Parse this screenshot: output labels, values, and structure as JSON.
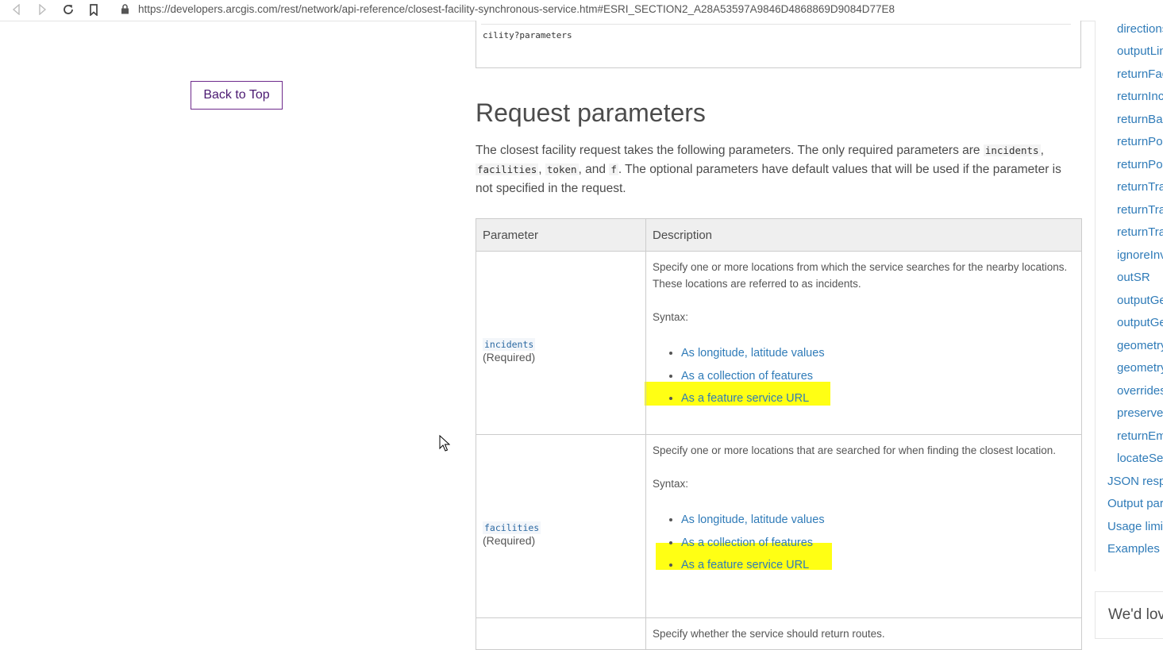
{
  "browser": {
    "url": "https://developers.arcgis.com/rest/network/api-reference/closest-facility-synchronous-service.htm#ESRI_SECTION2_A28A53597A9846D4868869D9084D77E8"
  },
  "back_to_top": "Back to Top",
  "code_snippet": "cility?parameters",
  "section_title": "Request parameters",
  "intro": {
    "t1": "The closest facility request takes the following parameters. The only required parameters are ",
    "c1": "incidents",
    "t2": ",",
    "c2": "facilities",
    "t3": ", ",
    "c3": "token",
    "t4": ", and ",
    "c4": "f",
    "t5": ". The optional parameters have default values that will be used if the parameter is not specified in the request."
  },
  "table": {
    "headers": {
      "param": "Parameter",
      "desc": "Description"
    },
    "rows": [
      {
        "name": "incidents",
        "required": "(Required)",
        "description": "Specify one or more locations from which the service searches for the nearby locations. These locations are referred to as incidents.",
        "syntax": "Syntax:",
        "links": [
          "As longitude, latitude values",
          "As a collection of features",
          "As a feature service URL"
        ]
      },
      {
        "name": "facilities",
        "required": "(Required)",
        "description": "Specify one or more locations that are searched for when finding the closest location.",
        "syntax": "Syntax:",
        "links": [
          "As longitude, latitude values",
          "As a collection of features",
          "As a feature service URL"
        ]
      },
      {
        "description": "Specify whether the service should return routes."
      }
    ]
  },
  "sidebar": {
    "sub_items": [
      "directionsL",
      "outputLine",
      "returnFacil",
      "returnIncid",
      "returnBarri",
      "returnPolyl",
      "returnPolyg",
      "returnTrave",
      "returnTrave",
      "returnTrave",
      "ignoreInval",
      "outSR",
      "outputGeom",
      "outputGeom",
      "geometryPr",
      "geometryPr",
      "overrides",
      "preserveOb",
      "returnEmpt",
      "locateSetti"
    ],
    "top_items": [
      "JSON respo",
      "Output para",
      "Usage limit",
      "Examples"
    ],
    "feedback": "We'd love"
  },
  "highlight_color": "#ffff14",
  "link_color": "#2f7bb8"
}
